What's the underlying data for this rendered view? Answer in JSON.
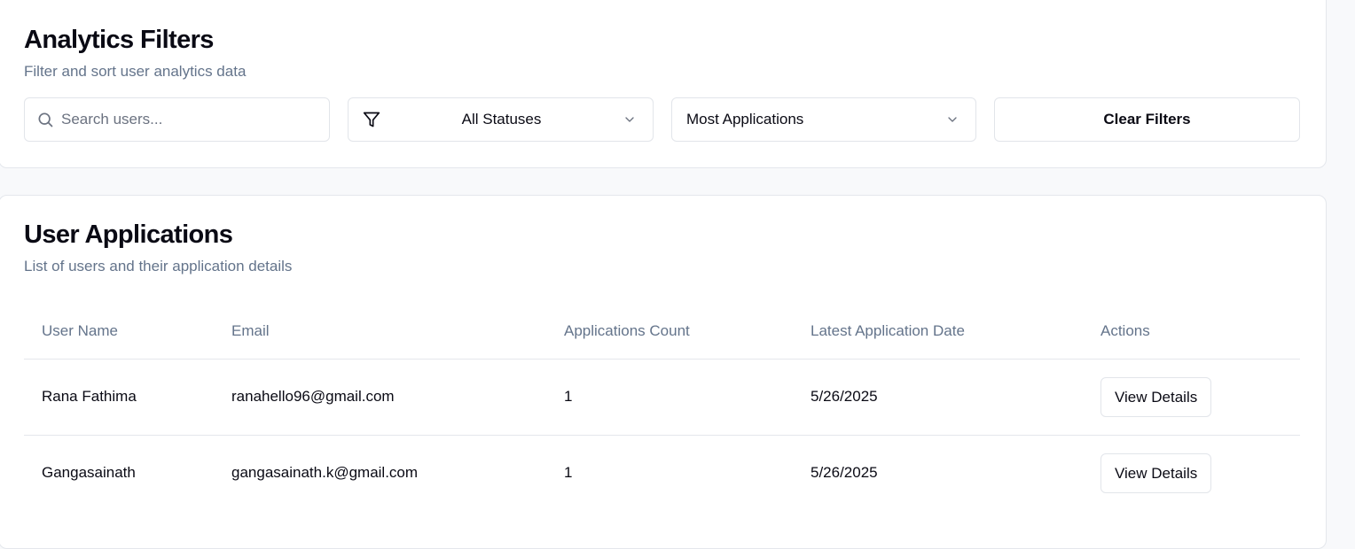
{
  "filters": {
    "title": "Analytics Filters",
    "subtitle": "Filter and sort user analytics data",
    "search": {
      "placeholder": "Search users...",
      "value": "",
      "icon": "search-icon"
    },
    "status_select": {
      "value": "All Statuses",
      "icon": "filter-icon"
    },
    "sort_select": {
      "value": "Most Applications"
    },
    "clear_label": "Clear Filters"
  },
  "applications": {
    "title": "User Applications",
    "subtitle": "List of users and their application details",
    "columns": [
      "User Name",
      "Email",
      "Applications Count",
      "Latest Application Date",
      "Actions"
    ],
    "rows": [
      {
        "name": "Rana Fathima",
        "email": "ranahello96@gmail.com",
        "count": "1",
        "date": "5/26/2025",
        "action": "View Details"
      },
      {
        "name": "Gangasainath",
        "email": "gangasainath.k@gmail.com",
        "count": "1",
        "date": "5/26/2025",
        "action": "View Details"
      }
    ]
  },
  "colors": {
    "background": "#f8f9fb",
    "card": "#ffffff",
    "border": "#e4e7ec",
    "muted_text": "#64748b",
    "text": "#0a0a14"
  }
}
